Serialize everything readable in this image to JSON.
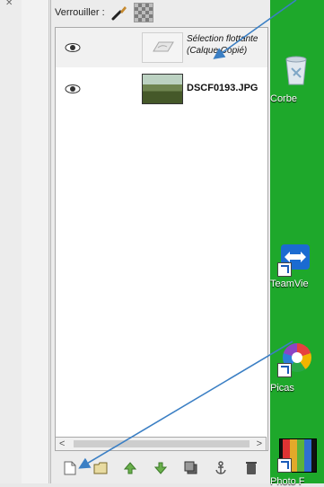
{
  "lock": {
    "label": "Verrouiller :"
  },
  "layers": [
    {
      "name_line1": "Sélection flottante",
      "name_line2": "(Calque Copié)",
      "visible": true,
      "thumb": "floating-selection"
    },
    {
      "name": "DSCF0193.JPG",
      "visible": true,
      "thumb": "photo"
    }
  ],
  "scroll": {
    "left": "<",
    "right": ">"
  },
  "actions": [
    "new-layer-icon",
    "layer-group-icon",
    "raise-layer-icon",
    "lower-layer-icon",
    "duplicate-layer-icon",
    "anchor-icon",
    "delete-layer-icon"
  ],
  "desktop": {
    "icons": [
      {
        "label": "Corbe",
        "icon": "recycle-bin-icon"
      },
      {
        "label": "TeamVie",
        "icon": "teamviewer-icon"
      },
      {
        "label": "Picas",
        "icon": "picasa-icon"
      },
      {
        "label": "Photo F",
        "icon": "photo-filtre-icon"
      }
    ]
  },
  "colors": {
    "desktop": "#1ea82b",
    "arrow": "#3b7fc4"
  }
}
